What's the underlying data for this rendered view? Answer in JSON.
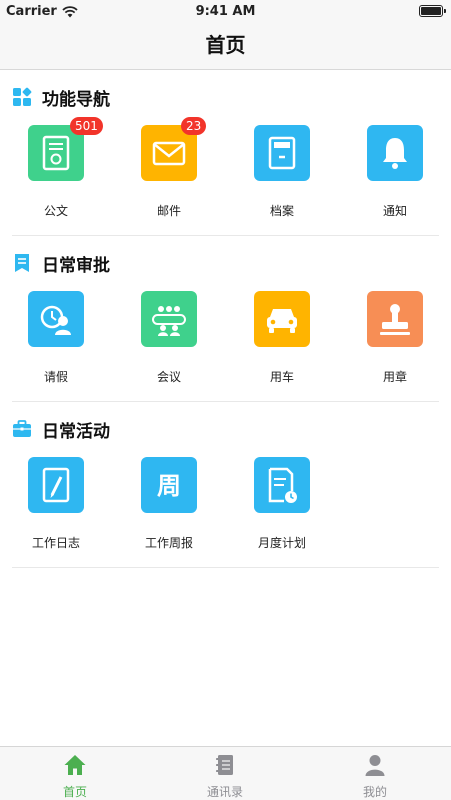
{
  "status_bar": {
    "carrier": "Carrier",
    "time": "9:41 AM"
  },
  "nav": {
    "title": "首页"
  },
  "sections": [
    {
      "title": "功能导航",
      "items": [
        {
          "label": "公文",
          "badge": "501"
        },
        {
          "label": "邮件",
          "badge": "23"
        },
        {
          "label": "档案"
        },
        {
          "label": "通知"
        }
      ]
    },
    {
      "title": "日常审批",
      "items": [
        {
          "label": "请假"
        },
        {
          "label": "会议"
        },
        {
          "label": "用车"
        },
        {
          "label": "用章"
        }
      ]
    },
    {
      "title": "日常活动",
      "items": [
        {
          "label": "工作日志"
        },
        {
          "label": "工作周报",
          "tile_glyph": "周"
        },
        {
          "label": "月度计划"
        }
      ]
    }
  ],
  "tabs": [
    {
      "label": "首页",
      "active": true
    },
    {
      "label": "通讯录",
      "active": false
    },
    {
      "label": "我的",
      "active": false
    }
  ],
  "colors": {
    "accent": "#4caf50",
    "tab_inactive": "#8e8e93",
    "badge": "#f2342a",
    "section_icon": "#2eb8f0"
  }
}
